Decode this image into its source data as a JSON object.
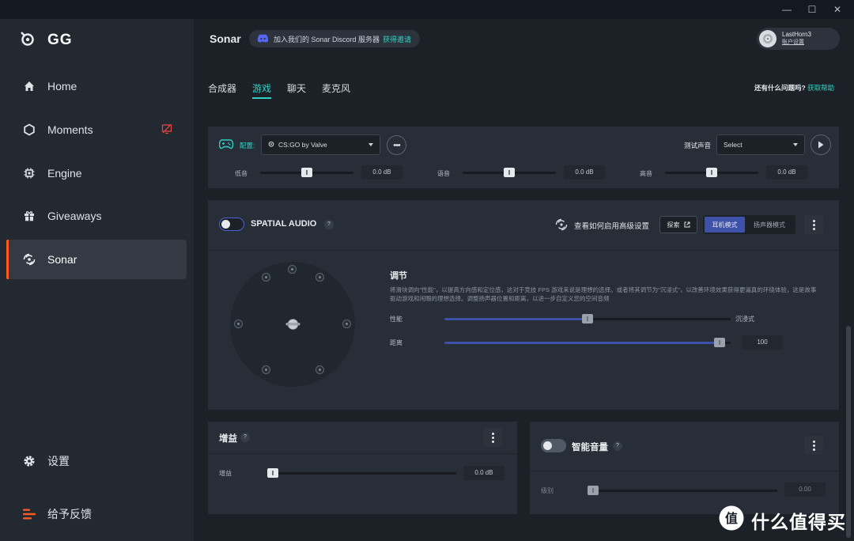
{
  "app": {
    "logo_text": "GG"
  },
  "window": {
    "minimize": "—",
    "maximize": "☐",
    "close": "✕"
  },
  "sidebar": {
    "items": [
      {
        "label": "Home",
        "icon": "home-icon"
      },
      {
        "label": "Moments",
        "icon": "hexagon-icon"
      },
      {
        "label": "Engine",
        "icon": "chip-icon"
      },
      {
        "label": "Giveaways",
        "icon": "gift-icon"
      },
      {
        "label": "Sonar",
        "icon": "sonar-icon",
        "active": true
      }
    ],
    "settings_label": "设置",
    "feedback_label": "给予反馈"
  },
  "header": {
    "title": "Sonar",
    "discord_text": "加入我们的 Sonar Discord 服务器",
    "discord_link": "获得邀请",
    "user_name": "LastHorn3",
    "user_settings": "账户设置"
  },
  "tabs": [
    "合成器",
    "游戏",
    "聊天",
    "麦克风"
  ],
  "active_tab": "游戏",
  "help": {
    "question": "还有什么问题吗?",
    "link": "获取帮助"
  },
  "config": {
    "label": "配置:",
    "preset": "CS:GO by Valve",
    "test_sound_label": "测试声音",
    "test_sound_value": "Select"
  },
  "eq": [
    {
      "label": "低音",
      "value": "0.0 dB",
      "level": 0.5
    },
    {
      "label": "语音",
      "value": "0.0 dB",
      "level": 0.5
    },
    {
      "label": "高音",
      "value": "0.0 dB",
      "level": 0.5
    }
  ],
  "spatial": {
    "title": "SPATIAL AUDIO",
    "question": "?",
    "advanced_text": "查看如何启用高级设置",
    "explore_label": "探索",
    "modes": [
      "耳机模式",
      "扬声器模式"
    ],
    "active_mode": "耳机模式",
    "adjust_title": "调节",
    "description": "将滑块调向\"性能\"，以提高方向感和定位感，这对于竞技 FPS 游戏来说是理想的选择。或者将其调节为\"沉浸式\"，以改善环境效果获得更逼真的环绕体验，这是故事驱动游戏和闲暇的理想选择。调整扬声器位置和距离，以进一步自定义您的空间音频",
    "balance": {
      "left_label": "性能",
      "right_label": "沉浸式",
      "level": 0.5
    },
    "distance": {
      "label": "距离",
      "value": "100",
      "level": 1.0
    }
  },
  "gain": {
    "title": "增益",
    "question": "?",
    "label": "增益",
    "value": "0.0 dB",
    "level": 0.0
  },
  "smart_volume": {
    "title": "智能音量",
    "question": "?",
    "label": "级别",
    "value": "0.00",
    "level": 0.0
  },
  "watermark": {
    "text": "什么值得买",
    "badge": "值"
  }
}
